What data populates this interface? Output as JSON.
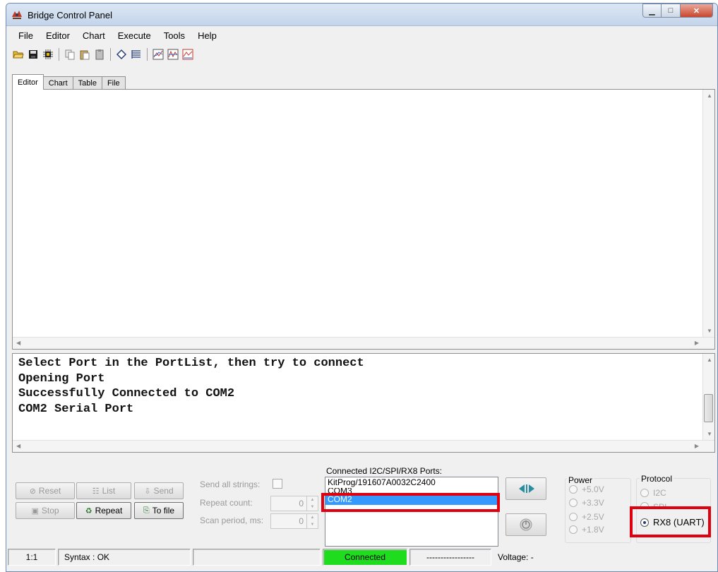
{
  "window": {
    "title": "Bridge Control Panel",
    "app_icon": "bridge-logo-icon"
  },
  "window_buttons": {
    "minimize": "minimize-icon",
    "maximize": "maximize-icon",
    "close": "close-icon"
  },
  "menu": [
    {
      "label": "File"
    },
    {
      "label": "Editor"
    },
    {
      "label": "Chart"
    },
    {
      "label": "Execute"
    },
    {
      "label": "Tools"
    },
    {
      "label": "Help"
    }
  ],
  "toolbar": {
    "icons": [
      "open-folder-icon",
      "save-icon",
      "chip-icon",
      "copy-icon",
      "paste-icon",
      "clipboard-icon",
      "eraser-icon",
      "list-icon",
      "chart-icon",
      "chart-icon",
      "chart-icon"
    ]
  },
  "tabs": [
    {
      "label": "Editor",
      "active": true
    },
    {
      "label": "Chart",
      "active": false
    },
    {
      "label": "Table",
      "active": false
    },
    {
      "label": "File",
      "active": false
    }
  ],
  "editor": {
    "content": ""
  },
  "log": {
    "lines": [
      "Select Port in the PortList, then try to connect",
      "Opening Port",
      "Successfully Connected to COM2",
      "COM2 Serial Port"
    ]
  },
  "controls": {
    "reset": "Reset",
    "list": "List",
    "send": "Send",
    "stop": "Stop",
    "repeat": "Repeat",
    "to_file": "To file",
    "send_all_strings": "Send all strings:",
    "send_all_checked": false,
    "repeat_count_label": "Repeat count:",
    "repeat_count_value": "0",
    "scan_period_label": "Scan period, ms:",
    "scan_period_value": "0"
  },
  "ports": {
    "label": "Connected I2C/SPI/RX8 Ports:",
    "items": [
      {
        "name": "KitProg/191607A0032C2400",
        "selected": false
      },
      {
        "name": "COM3",
        "selected": false
      },
      {
        "name": "COM2",
        "selected": true
      }
    ]
  },
  "power": {
    "title": "Power",
    "options": [
      "+5.0V",
      "+3.3V",
      "+2.5V",
      "+1.8V"
    ],
    "selected": null
  },
  "protocol": {
    "title": "Protocol",
    "options": [
      "I2C",
      "SPI",
      "RX8 (UART)"
    ],
    "selected": "RX8 (UART)"
  },
  "status": {
    "position": "1:1",
    "syntax": "Syntax : OK",
    "message": "",
    "connection": "Connected",
    "indicator": "-----------------",
    "voltage": "Voltage: -"
  },
  "colors": {
    "connected_bg": "#1fdc1f",
    "highlight": "#e0000e",
    "selection": "#3399ff",
    "connect_arrows": "#2a8c9e"
  }
}
